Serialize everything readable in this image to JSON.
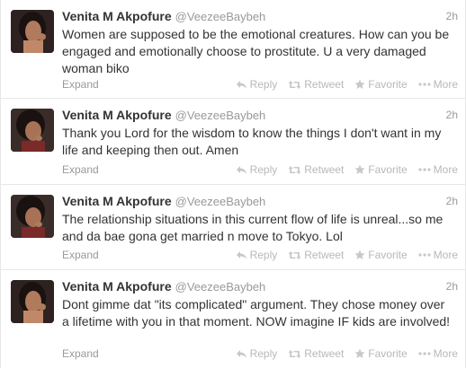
{
  "tweets": [
    {
      "fullname": "Venita M Akpofure",
      "username": "@VeezeeBaybeh",
      "time": "2h",
      "text": "Women are supposed to be the emotional creatures. How can you be engaged and emotionally choose to prostitute. U a very damaged woman biko",
      "expand": "Expand"
    },
    {
      "fullname": "Venita M Akpofure",
      "username": "@VeezeeBaybeh",
      "time": "2h",
      "text": "Thank you Lord for the wisdom to know the things I don't want in my life and keeping then out. Amen",
      "expand": "Expand"
    },
    {
      "fullname": "Venita M Akpofure",
      "username": "@VeezeeBaybeh",
      "time": "2h",
      "text": "The relationship situations in this current flow of life is unreal...so me and da bae gona get married n move to Tokyo.  Lol",
      "expand": "Expand"
    },
    {
      "fullname": "Venita M Akpofure",
      "username": "@VeezeeBaybeh",
      "time": "2h",
      "text": "Dont gimme dat \"its complicated\" argument. They chose money over a lifetime with you in that moment.  NOW imagine IF kids are involved!",
      "expand": "Expand"
    }
  ],
  "actions": {
    "reply": "Reply",
    "retweet": "Retweet",
    "favorite": "Favorite",
    "more": "More"
  },
  "icons": {
    "reply": "reply-arrow-icon",
    "retweet": "retweet-icon",
    "favorite": "star-icon",
    "more": "ellipsis-icon"
  },
  "colors": {
    "text": "#333333",
    "muted": "#999999",
    "action": "#b8b8b8",
    "divider": "#e8e8e8"
  }
}
